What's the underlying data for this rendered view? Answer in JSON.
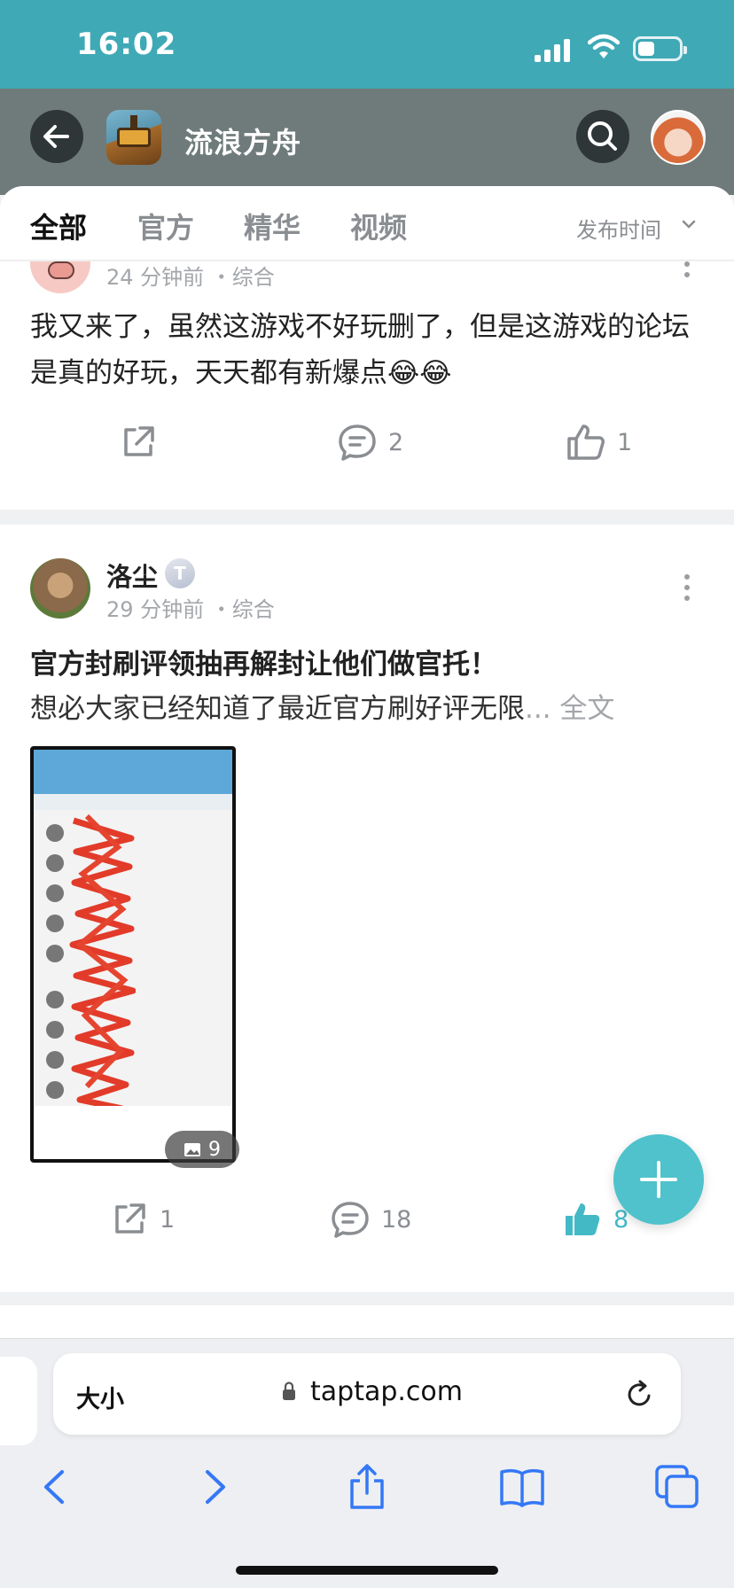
{
  "status_bar": {
    "time": "16:02"
  },
  "header": {
    "title": "流浪方舟"
  },
  "tabs": [
    {
      "label": "全部",
      "active": true
    },
    {
      "label": "官方",
      "active": false
    },
    {
      "label": "精华",
      "active": false
    },
    {
      "label": "视频",
      "active": false
    }
  ],
  "sort": {
    "label": "发布时间"
  },
  "posts": [
    {
      "author": "",
      "meta": "24 分钟前 ・综合",
      "title": "",
      "body": "我又来了，虽然这游戏不好玩删了，但是这游戏的论坛是真的好玩，天天都有新爆点😂😂",
      "shares": "",
      "comments": "2",
      "likes": "1"
    },
    {
      "author": "洛尘",
      "level_badge": "T",
      "meta": "29 分钟前 ・综合",
      "title": "官方封刷评领抽再解封让他们做官托！",
      "snippet": "想必大家已经知道了最近官方刷好评无限",
      "snippet_more": "... 全文",
      "image_count": "9",
      "shares": "1",
      "comments": "18",
      "likes": "8",
      "liked": true
    }
  ],
  "browser": {
    "text_size_label": "大小",
    "url": "taptap.com"
  },
  "colors": {
    "accent": "#44b9c6",
    "status_bar": "#3fa9b6",
    "header_bg": "#6f7b7a",
    "safari_blue": "#3478f6"
  }
}
